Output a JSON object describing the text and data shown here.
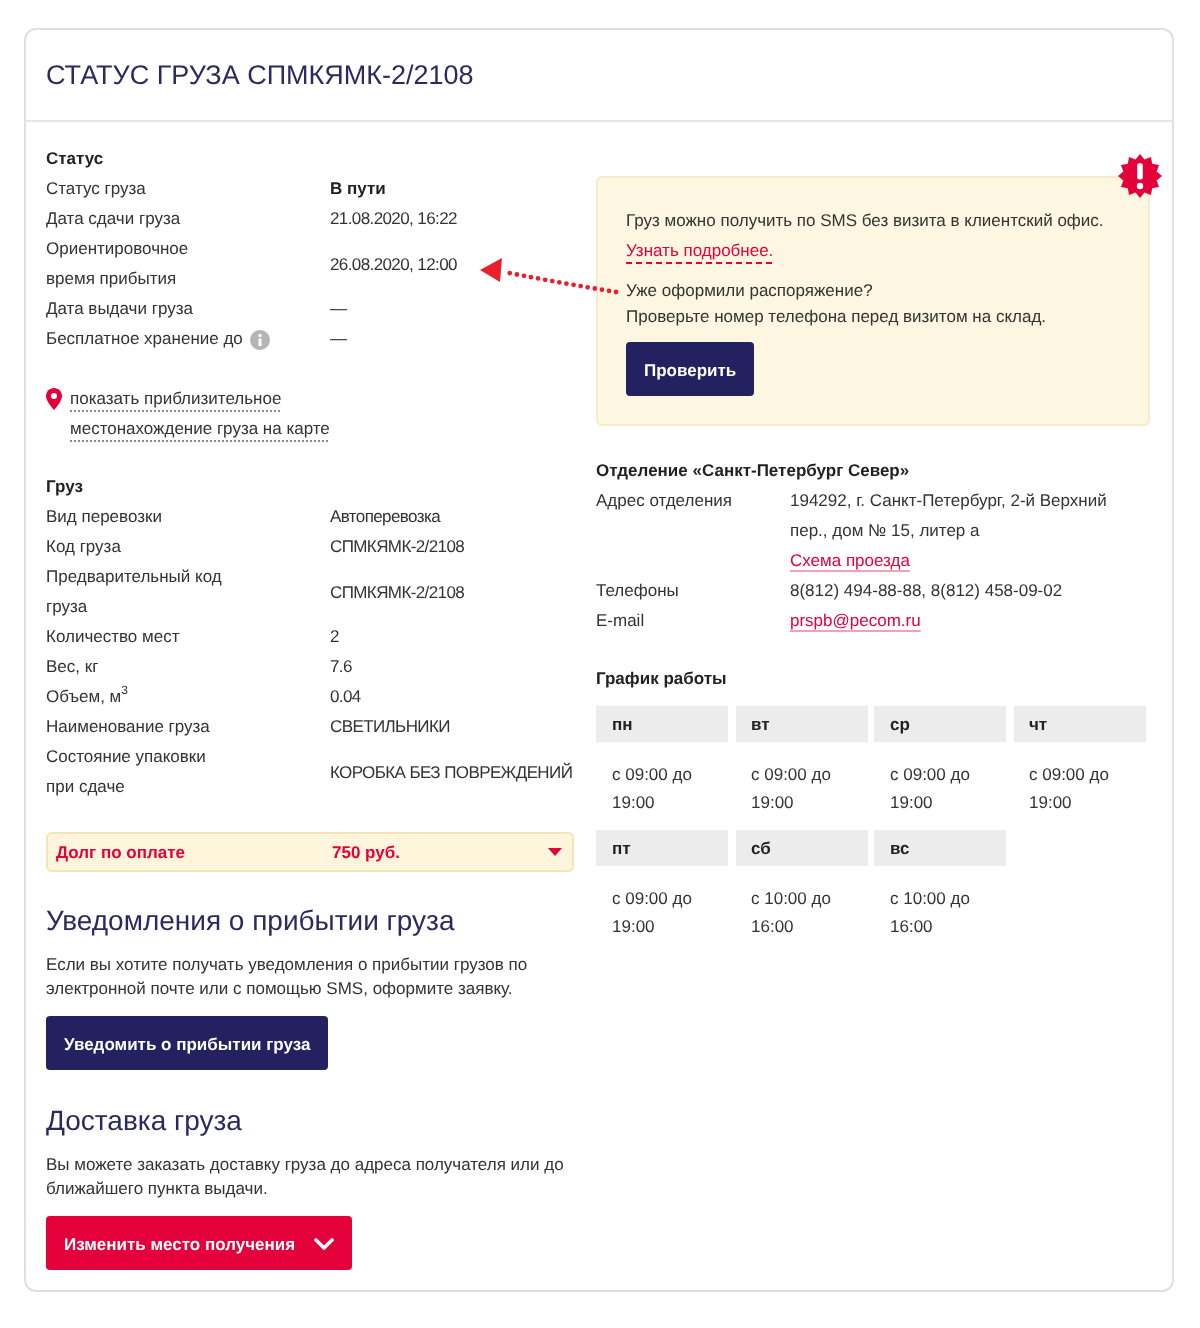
{
  "title": "СТАТУС ГРУЗА СПМКЯМК-2/2108",
  "status": {
    "heading": "Статус",
    "rows": [
      {
        "label": "Статус груза",
        "value": "В пути",
        "bold": true,
        "info": false
      },
      {
        "label": "Дата сдачи груза",
        "value": "21.08.2020, 16:22",
        "bold": false,
        "info": false
      },
      {
        "label": "Ориентировочное время прибытия",
        "value": "26.08.2020, 12:00",
        "bold": false,
        "info": false
      },
      {
        "label": "Дата выдачи груза",
        "value": "—",
        "bold": false,
        "info": false
      },
      {
        "label": "Бесплатное хранение до",
        "value": "—",
        "bold": false,
        "info": true
      }
    ],
    "map_link": "показать приблизительное местонахождение груза на карте"
  },
  "cargo": {
    "heading": "Груз",
    "rows": [
      {
        "label": "Вид перевозки",
        "value": "Автоперевозка"
      },
      {
        "label": "Код груза",
        "value": "СПМКЯМК-2/2108"
      },
      {
        "label": "Предварительный код груза",
        "value": "СПМКЯМК-2/2108"
      },
      {
        "label": "Количество мест",
        "value": "2"
      },
      {
        "label": "Вес, кг",
        "value": "7.6"
      },
      {
        "label": "Объем, м$^{3}$",
        "value": "0.04"
      },
      {
        "label": "Наименование груза",
        "value": "СВЕТИЛЬНИКИ"
      },
      {
        "label": "Состояние упаковки при сдаче",
        "value": "КОРОБКА БЕЗ ПОВРЕЖДЕНИЙ"
      }
    ]
  },
  "debt": {
    "label": "Долг по оплате",
    "amount": "750 руб.",
    "expanded": false
  },
  "notifications": {
    "heading": "Уведомления о прибытии груза",
    "text": "Если вы хотите получать уведомления о прибытии грузов по электронной почте или с помощью SMS, оформите заявку.",
    "button": "Уведомить о прибытии груза"
  },
  "delivery": {
    "heading": "Доставка груза",
    "text": "Вы можете заказать доставку груза до адреса получателя или до ближайшего пункта выдачи.",
    "button": "Изменить место получения"
  },
  "sms_notice": {
    "text": "Груз можно получить по SMS без визита в клиентский офис.",
    "link": "Узнать подробнее.",
    "question": "Уже оформили распоряжение?",
    "hint": "Проверьте номер телефона перед визитом на склад.",
    "button": "Проверить"
  },
  "office": {
    "title": "Отделение «Санкт-Петербург Север»",
    "rows": [
      {
        "label": "Адрес отделения",
        "value": "194292, г. Санкт-Петербург, 2-й Верхний пер., дом № 15, литер а",
        "link": "Схема проезда"
      },
      {
        "label": "Телефоны",
        "value": "8(812) 494-88-88, 8(812) 458-09-02"
      },
      {
        "label": "E-mail",
        "link": "prspb@pecom.ru"
      }
    ]
  },
  "schedule": {
    "heading": "График работы",
    "days": [
      {
        "day": "пн",
        "hours": "с 09:00 до 19:00"
      },
      {
        "day": "вт",
        "hours": "с 09:00 до 19:00"
      },
      {
        "day": "ср",
        "hours": "с 09:00 до 19:00"
      },
      {
        "day": "чт",
        "hours": "с 09:00 до 19:00"
      },
      {
        "day": "пт",
        "hours": "с 09:00 до 19:00"
      },
      {
        "day": "сб",
        "hours": "с 10:00 до 16:00"
      },
      {
        "day": "вс",
        "hours": "с 10:00 до 16:00"
      }
    ]
  }
}
